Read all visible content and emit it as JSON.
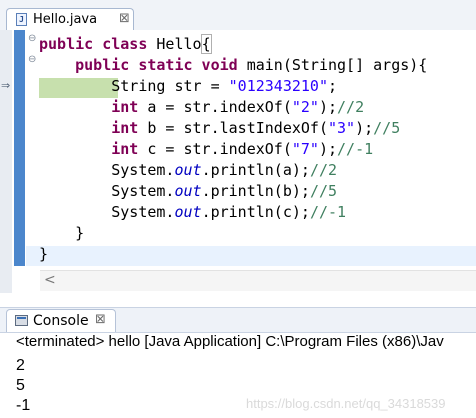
{
  "editor": {
    "tab": {
      "title": "Hello.java",
      "close": "⊠"
    },
    "code_lines": [
      [
        {
          "t": "public class ",
          "c": "kw"
        },
        {
          "t": "Hello",
          "c": ""
        },
        {
          "t": "{",
          "c": "bracket"
        }
      ],
      [
        {
          "t": "    ",
          "c": ""
        },
        {
          "t": "public static void ",
          "c": "kw"
        },
        {
          "t": "main(String[] args){",
          "c": ""
        }
      ],
      [
        {
          "t": "        String str = ",
          "c": ""
        },
        {
          "t": "\"012343210\"",
          "c": "str"
        },
        {
          "t": ";",
          "c": ""
        }
      ],
      [
        {
          "t": "        ",
          "c": ""
        },
        {
          "t": "int ",
          "c": "kw"
        },
        {
          "t": "a = str.indexOf(",
          "c": ""
        },
        {
          "t": "\"2\"",
          "c": "str"
        },
        {
          "t": ");",
          "c": ""
        },
        {
          "t": "//2",
          "c": "cmt"
        }
      ],
      [
        {
          "t": "        ",
          "c": ""
        },
        {
          "t": "int ",
          "c": "kw"
        },
        {
          "t": "b = str.lastIndexOf(",
          "c": ""
        },
        {
          "t": "\"3\"",
          "c": "str"
        },
        {
          "t": ");",
          "c": ""
        },
        {
          "t": "//5",
          "c": "cmt"
        }
      ],
      [
        {
          "t": "        ",
          "c": ""
        },
        {
          "t": "int ",
          "c": "kw"
        },
        {
          "t": "c = str.indexOf(",
          "c": ""
        },
        {
          "t": "\"7\"",
          "c": "str"
        },
        {
          "t": ");",
          "c": ""
        },
        {
          "t": "//-1",
          "c": "cmt"
        }
      ],
      [
        {
          "t": "        System.",
          "c": ""
        },
        {
          "t": "out",
          "c": "fld"
        },
        {
          "t": ".println(a);",
          "c": ""
        },
        {
          "t": "//2",
          "c": "cmt"
        }
      ],
      [
        {
          "t": "        System.",
          "c": ""
        },
        {
          "t": "out",
          "c": "fld"
        },
        {
          "t": ".println(b);",
          "c": ""
        },
        {
          "t": "//5",
          "c": "cmt"
        }
      ],
      [
        {
          "t": "        System.",
          "c": ""
        },
        {
          "t": "out",
          "c": "fld"
        },
        {
          "t": ".println(c);",
          "c": ""
        },
        {
          "t": "//-1",
          "c": "cmt"
        }
      ],
      [
        {
          "t": "    }",
          "c": ""
        }
      ],
      [
        {
          "t": "}",
          "c": ""
        }
      ]
    ],
    "fold_icons": [
      "⊖",
      "⊖"
    ],
    "debug_marker": "⇒",
    "scroll_arrow": "<"
  },
  "console": {
    "tab": {
      "title": "Console",
      "close": "⊠"
    },
    "status": "<terminated> hello [Java Application] C:\\Program Files (x86)\\Jav",
    "output": [
      "2",
      "5",
      "-1"
    ]
  },
  "watermark": "https://blog.csdn.net/qq_34318539",
  "colors": {
    "keyword": "#7f0055",
    "string": "#2a00ff",
    "comment": "#3f7f5f",
    "field": "#0000c0",
    "exec_highlight": "#c7e0ad",
    "overview_bar": "#4b86cc"
  }
}
